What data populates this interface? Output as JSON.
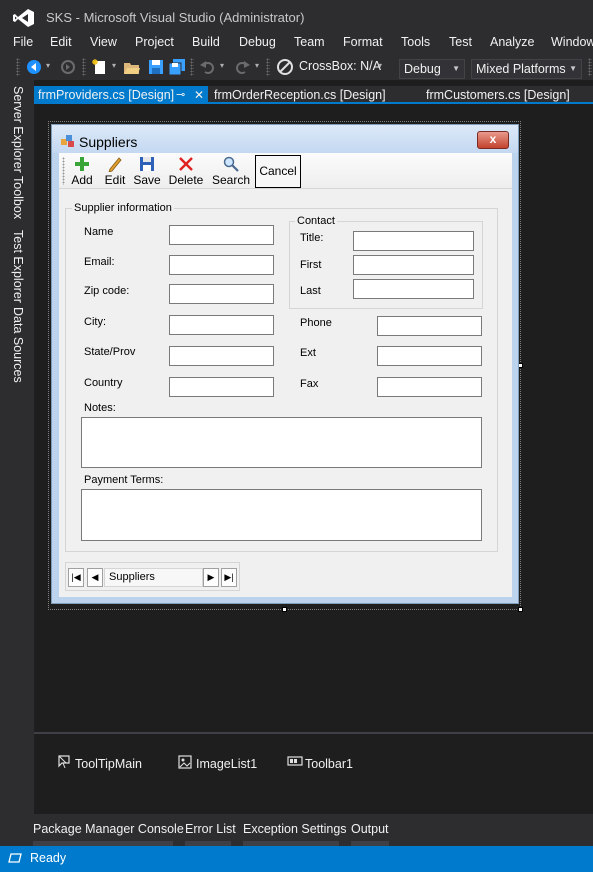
{
  "window": {
    "title": "SKS - Microsoft Visual Studio  (Administrator)",
    "logo_icon": "visual-studio-logo"
  },
  "menu": [
    "File",
    "Edit",
    "View",
    "Project",
    "Build",
    "Debug",
    "Team",
    "Format",
    "Tools",
    "Test",
    "Analyze",
    "Window"
  ],
  "toolbar": {
    "crossbox_label": "CrossBox: N/A",
    "configuration": "Debug",
    "platform": "Mixed Platforms"
  },
  "doc_tabs": {
    "active": "frmProviders.cs [Design]",
    "tab2": "frmOrderReception.cs [Design]",
    "tab3": "frmCustomers.cs [Design]",
    "pin_glyph": "⊸",
    "close_glyph": "✕"
  },
  "side_tabs": [
    "Server Explorer",
    "Toolbox",
    "Test Explorer",
    "Data Sources"
  ],
  "form": {
    "title": "Suppliers",
    "close_glyph": "x",
    "toolbar": {
      "add": "Add",
      "edit": "Edit",
      "save": "Save",
      "delete": "Delete",
      "search": "Search",
      "cancel": "Cancel"
    },
    "supplier_group": "Supplier information",
    "contact_group": "Contact",
    "labels": {
      "name": "Name",
      "email": "Email:",
      "zip": "Zip code:",
      "city": "City:",
      "state": "State/Prov",
      "country": "Country",
      "title": "Title:",
      "first": "First",
      "last": "Last",
      "phone": "Phone",
      "ext": "Ext",
      "fax": "Fax",
      "notes": "Notes:",
      "payment_terms": "Payment Terms:"
    },
    "navigator": {
      "first": "|◀",
      "prev": "◀",
      "label": "Suppliers",
      "next": "▶",
      "last": "▶|"
    }
  },
  "tray": [
    "ToolTipMain",
    "ImageList1",
    "Toolbar1"
  ],
  "bottom_tabs": [
    "Package Manager Console",
    "Error List",
    "Exception Settings",
    "Output"
  ],
  "status": {
    "text": "Ready"
  },
  "colors": {
    "accent": "#007acc",
    "chrome": "#2d2d30",
    "editor": "#1e1e1e"
  }
}
